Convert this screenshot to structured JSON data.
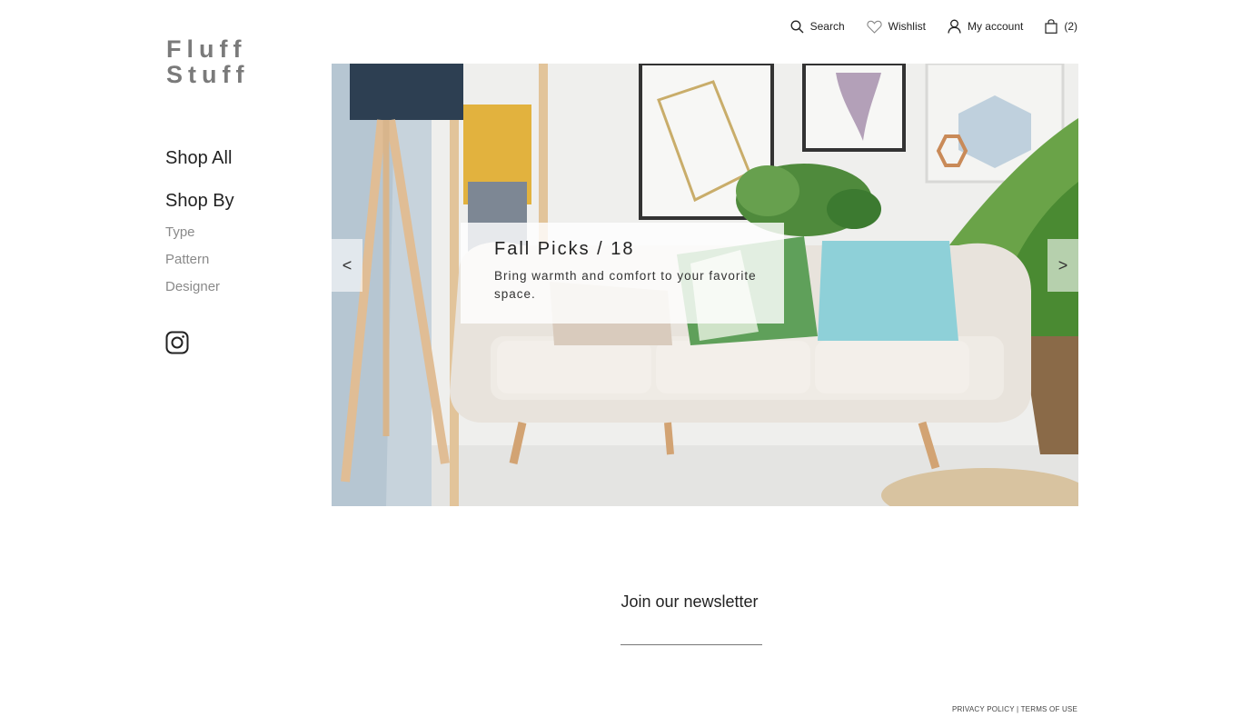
{
  "brand": {
    "line1": "Fluff",
    "line2": "Stuff"
  },
  "sidebar": {
    "shop_all": "Shop All",
    "shop_by": "Shop By",
    "items": [
      {
        "label": "Type"
      },
      {
        "label": "Pattern"
      },
      {
        "label": "Designer"
      }
    ],
    "social_icon": "instagram-icon"
  },
  "topbar": {
    "search": {
      "label": "Search",
      "icon": "search-icon"
    },
    "wishlist": {
      "label": "Wishlist",
      "icon": "heart-icon"
    },
    "account": {
      "label": "My account",
      "icon": "user-icon"
    },
    "cart": {
      "label": "(2)",
      "icon": "shopping-bag-icon"
    }
  },
  "hero": {
    "title": "Fall Picks / 18",
    "subtitle": "Bring warmth and comfort to your favorite space.",
    "prev": "<",
    "next": ">"
  },
  "newsletter": {
    "title": "Join our newsletter",
    "placeholder": ""
  },
  "footer": {
    "privacy": "PRIVACY POLICY",
    "separator": "|",
    "terms": "TERMS OF USE"
  }
}
